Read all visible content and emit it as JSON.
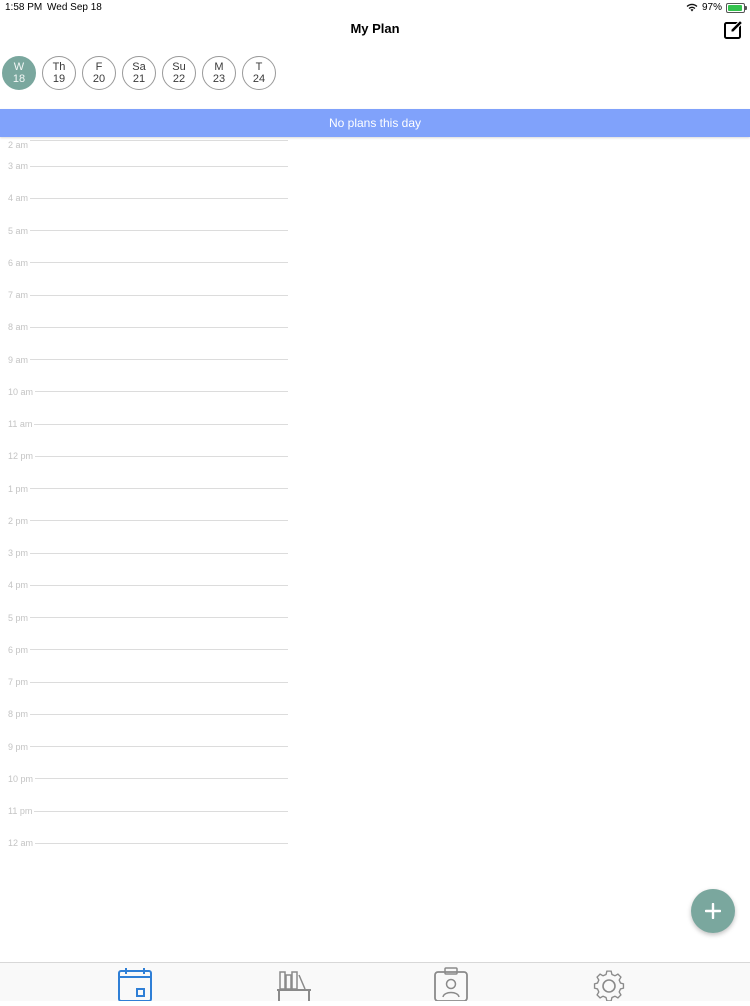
{
  "status": {
    "time": "1:58 PM",
    "date": "Wed Sep 18",
    "battery": "97%",
    "icons": [
      "wifi-icon",
      "battery-icon"
    ]
  },
  "nav": {
    "title": "My Plan",
    "edit_icon": "compose-icon"
  },
  "days": [
    {
      "dow": "W",
      "day": "18",
      "selected": true
    },
    {
      "dow": "Th",
      "day": "19",
      "selected": false
    },
    {
      "dow": "F",
      "day": "20",
      "selected": false
    },
    {
      "dow": "Sa",
      "day": "21",
      "selected": false
    },
    {
      "dow": "Su",
      "day": "22",
      "selected": false
    },
    {
      "dow": "M",
      "day": "23",
      "selected": false
    },
    {
      "dow": "T",
      "day": "24",
      "selected": false
    }
  ],
  "banner": {
    "text": "No plans this day"
  },
  "timeline": {
    "hours": [
      "2 am",
      "3 am",
      "4 am",
      "5 am",
      "6 am",
      "7 am",
      "8 am",
      "9 am",
      "10 am",
      "11 am",
      "12 pm",
      "1 pm",
      "2 pm",
      "3 pm",
      "4 pm",
      "5 pm",
      "6 pm",
      "7 pm",
      "8 pm",
      "9 pm",
      "10 pm",
      "11 pm",
      "12 am"
    ]
  },
  "fab": {
    "icon": "plus-icon"
  },
  "tabs": [
    {
      "name": "tab-plan",
      "icon": "calendar-icon",
      "active": true
    },
    {
      "name": "tab-library",
      "icon": "bookshelf-icon",
      "active": false
    },
    {
      "name": "tab-profile",
      "icon": "contact-badge-icon",
      "active": false
    },
    {
      "name": "tab-settings",
      "icon": "gear-icon",
      "active": false
    }
  ],
  "colors": {
    "accent": "#7aa79e",
    "banner": "#80a2fb",
    "tab_active": "#2f7fd6",
    "tab_inactive": "#8a8a8a"
  }
}
